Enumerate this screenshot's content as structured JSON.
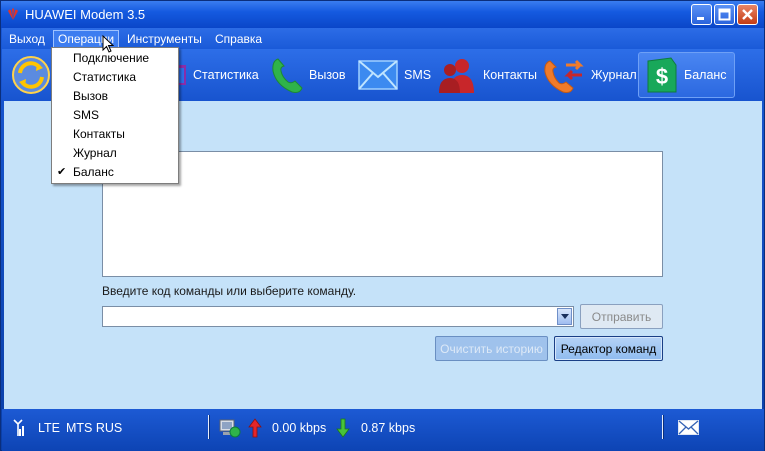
{
  "window": {
    "title": "HUAWEI Modem 3.5"
  },
  "menubar": {
    "items": [
      "Выход",
      "Операции",
      "Инструменты",
      "Справка"
    ],
    "active": "Операции"
  },
  "ops_menu": {
    "items": [
      "Подключение",
      "Статистика",
      "Вызов",
      "SMS",
      "Контакты",
      "Журнал",
      "Баланс"
    ],
    "checked": "Баланс"
  },
  "toolbar": {
    "items": [
      {
        "id": "connect",
        "label": "",
        "icon": "connect-icon"
      },
      {
        "id": "stats",
        "label": "Статистика",
        "icon": "statistics-icon"
      },
      {
        "id": "call",
        "label": "Вызов",
        "icon": "phone-icon"
      },
      {
        "id": "sms",
        "label": "SMS",
        "icon": "envelope-icon"
      },
      {
        "id": "contacts",
        "label": "Контакты",
        "icon": "contacts-icon"
      },
      {
        "id": "journal",
        "label": "Журнал",
        "icon": "call-log-icon"
      },
      {
        "id": "balance",
        "label": "Баланс",
        "icon": "dollar-icon"
      }
    ],
    "active": "balance"
  },
  "balance": {
    "history": "",
    "command_prompt": "Введите код команды или выберите команду.",
    "command_value": "",
    "send_label": "Отправить",
    "clear_history_label": "Очистить историю",
    "command_editor_label": "Редактор команд"
  },
  "status": {
    "network_type": "LTE",
    "operator": "MTS RUS",
    "upload_speed": "0.00 kbps",
    "download_speed": "0.87 kbps"
  },
  "colors": {
    "titlebar": "#155ae0",
    "content_bg": "#c5e2f9",
    "statusbar": "#0d44b4"
  }
}
